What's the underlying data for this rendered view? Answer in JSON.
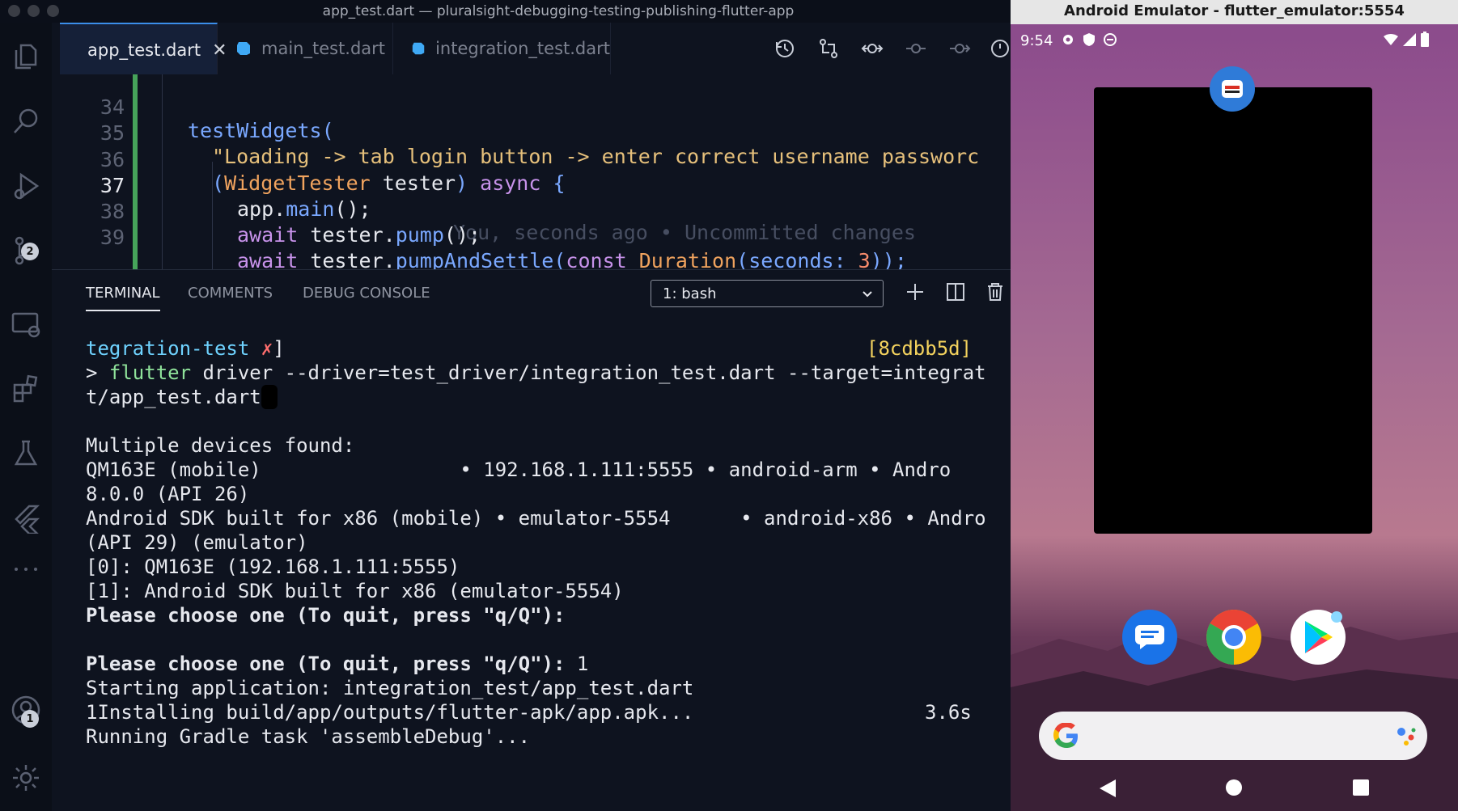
{
  "window": {
    "title": "app_test.dart — pluralsight-debugging-testing-publishing-flutter-app"
  },
  "activity_bar": {
    "scm_badge": "2",
    "accounts_badge": "1"
  },
  "tabs": [
    {
      "label": "app_test.dart",
      "active": true
    },
    {
      "label": "main_test.dart",
      "active": false
    },
    {
      "label": "integration_test.dart",
      "active": false
    }
  ],
  "editor": {
    "lines": [
      {
        "num": "34"
      },
      {
        "num": "35"
      },
      {
        "num": "36"
      },
      {
        "num": "37"
      },
      {
        "num": "38"
      },
      {
        "num": "39"
      }
    ],
    "code": {
      "l34_fn": "testWidgets",
      "l34_open": "(",
      "l35_str": "\"Loading -> tab login button -> enter correct username passworc",
      "l36_open": "(",
      "l36_type": "WidgetTester",
      "l36_param": " tester",
      "l36_close": ") ",
      "l36_kw": "async",
      "l36_brace": " {",
      "l37_obj": "app.",
      "l37_fn": "main",
      "l37_rest": "();",
      "l37_blame": "You, seconds ago • Uncommitted changes",
      "l38_kw": "await",
      "l38_obj": " tester.",
      "l38_fn": "pump",
      "l38_rest": "();",
      "l39_kw": "await",
      "l39_obj": " tester.",
      "l39_fn": "pumpAndSettle",
      "l39_open": "(",
      "l39_kw2": "const",
      "l39_cls": " Duration",
      "l39_arg": "(seconds: ",
      "l39_num": "3",
      "l39_end": "));"
    }
  },
  "panel": {
    "tabs": [
      "TERMINAL",
      "COMMENTS",
      "DEBUG CONSOLE"
    ],
    "shell_select": "1: bash"
  },
  "terminal": {
    "branch": "tegration-test",
    "branch_mark": "✗",
    "branch_close": "]",
    "commit": "[8cdbb5d]",
    "prompt": ">",
    "cmd": "flutter",
    "cmd_args": " driver --driver=test_driver/integration_test.dart --target=integrat",
    "cmd_wrap": "t/app_test.dart",
    "lines": [
      "Multiple devices found:",
      "QM163E (mobile)                 • 192.168.1.111:5555 • android-arm • Andro",
      "8.0.0 (API 26)",
      "Android SDK built for x86 (mobile) • emulator-5554      • android-x86 • Andro",
      "(API 29) (emulator)",
      "[0]: QM163E (192.168.1.111:5555)",
      "[1]: Android SDK built for x86 (emulator-5554)",
      "Please choose one (To quit, press \"q/Q\"):",
      "",
      "Please choose one (To quit, press \"q/Q\"): 1",
      "Starting application: integration_test/app_test.dart",
      "1Installing build/app/outputs/flutter-apk/app.apk...",
      "Running Gradle task 'assembleDebug'..."
    ],
    "timing": "3.6s"
  },
  "emulator": {
    "title": "Android Emulator - flutter_emulator:5554",
    "time": "9:54",
    "colors": {
      "wallpaper_top": "#8b4b8c",
      "app_icon": "#2f7bd8",
      "messages": "#1a73e8"
    }
  }
}
